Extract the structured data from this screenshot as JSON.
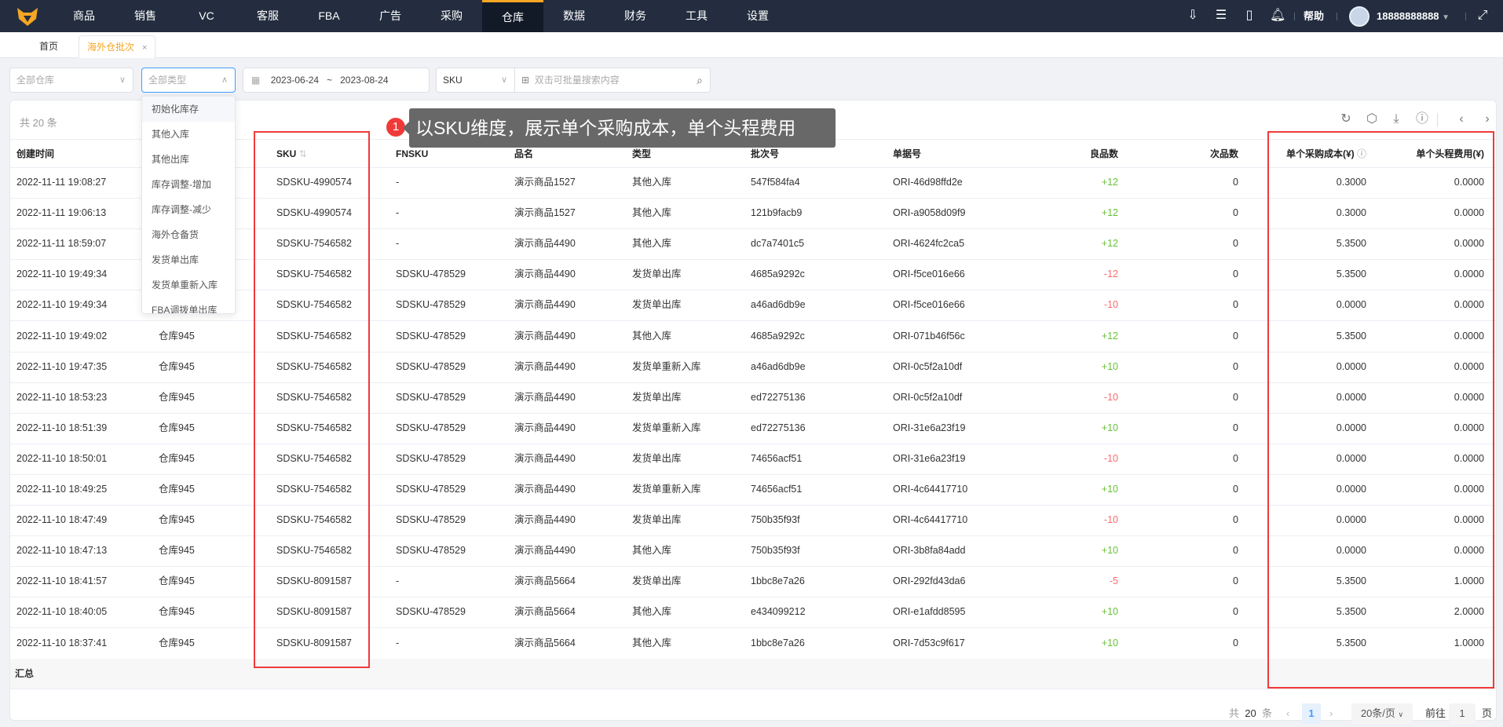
{
  "nav": {
    "items": [
      "商品",
      "销售",
      "VC",
      "客服",
      "FBA",
      "广告",
      "采购",
      "仓库",
      "数据",
      "财务",
      "工具",
      "设置"
    ],
    "active": 7,
    "help": "帮助",
    "user": "18888888888"
  },
  "tabs": {
    "home": "首页",
    "active": "海外仓批次",
    "close": "×"
  },
  "filters": {
    "warehouse": "全部仓库",
    "type": "全部类型",
    "date_start": "2023-06-24",
    "date_sep": "~",
    "date_end": "2023-08-24",
    "search_field": "SKU",
    "search_placeholder": "双击可批量搜索内容"
  },
  "dropdown": [
    "初始化库存",
    "其他入库",
    "其他出库",
    "库存调整-增加",
    "库存调整-减少",
    "海外仓备货",
    "发货单出库",
    "发货单重新入库",
    "FBA调拨单出库"
  ],
  "annotation": {
    "number": "1",
    "text": "以SKU维度，展示单个采购成本，单个头程费用"
  },
  "table": {
    "count": "共 20 条",
    "headers": {
      "time": "创建时间",
      "warehouse": "",
      "sku": "SKU",
      "fnsku": "FNSKU",
      "name": "品名",
      "type": "类型",
      "batch": "批次号",
      "doc": "单据号",
      "good": "良品数",
      "bad": "次品数",
      "cost": "单个采购成本(¥)",
      "freight": "单个头程费用(¥)"
    },
    "rows": [
      [
        "2022-11-11 19:08:27",
        "",
        "SDSKU-4990574",
        "-",
        "演示商品1527",
        "其他入库",
        "547f584fa4",
        "ORI-46d98ffd2e",
        "+12",
        "0",
        "0.3000",
        "0.0000"
      ],
      [
        "2022-11-11 19:06:13",
        "",
        "SDSKU-4990574",
        "-",
        "演示商品1527",
        "其他入库",
        "121b9facb9",
        "ORI-a9058d09f9",
        "+12",
        "0",
        "0.3000",
        "0.0000"
      ],
      [
        "2022-11-11 18:59:07",
        "",
        "SDSKU-7546582",
        "-",
        "演示商品4490",
        "其他入库",
        "dc7a7401c5",
        "ORI-4624fc2ca5",
        "+12",
        "0",
        "5.3500",
        "0.0000"
      ],
      [
        "2022-11-10 19:49:34",
        "",
        "SDSKU-7546582",
        "SDSKU-478529",
        "演示商品4490",
        "发货单出库",
        "4685a9292c",
        "ORI-f5ce016e66",
        "-12",
        "0",
        "5.3500",
        "0.0000"
      ],
      [
        "2022-11-10 19:49:34",
        "",
        "SDSKU-7546582",
        "SDSKU-478529",
        "演示商品4490",
        "发货单出库",
        "a46ad6db9e",
        "ORI-f5ce016e66",
        "-10",
        "0",
        "0.0000",
        "0.0000"
      ],
      [
        "2022-11-10 19:49:02",
        "仓库945",
        "SDSKU-7546582",
        "SDSKU-478529",
        "演示商品4490",
        "其他入库",
        "4685a9292c",
        "ORI-071b46f56c",
        "+12",
        "0",
        "5.3500",
        "0.0000"
      ],
      [
        "2022-11-10 19:47:35",
        "仓库945",
        "SDSKU-7546582",
        "SDSKU-478529",
        "演示商品4490",
        "发货单重新入库",
        "a46ad6db9e",
        "ORI-0c5f2a10df",
        "+10",
        "0",
        "0.0000",
        "0.0000"
      ],
      [
        "2022-11-10 18:53:23",
        "仓库945",
        "SDSKU-7546582",
        "SDSKU-478529",
        "演示商品4490",
        "发货单出库",
        "ed72275136",
        "ORI-0c5f2a10df",
        "-10",
        "0",
        "0.0000",
        "0.0000"
      ],
      [
        "2022-11-10 18:51:39",
        "仓库945",
        "SDSKU-7546582",
        "SDSKU-478529",
        "演示商品4490",
        "发货单重新入库",
        "ed72275136",
        "ORI-31e6a23f19",
        "+10",
        "0",
        "0.0000",
        "0.0000"
      ],
      [
        "2022-11-10 18:50:01",
        "仓库945",
        "SDSKU-7546582",
        "SDSKU-478529",
        "演示商品4490",
        "发货单出库",
        "74656acf51",
        "ORI-31e6a23f19",
        "-10",
        "0",
        "0.0000",
        "0.0000"
      ],
      [
        "2022-11-10 18:49:25",
        "仓库945",
        "SDSKU-7546582",
        "SDSKU-478529",
        "演示商品4490",
        "发货单重新入库",
        "74656acf51",
        "ORI-4c64417710",
        "+10",
        "0",
        "0.0000",
        "0.0000"
      ],
      [
        "2022-11-10 18:47:49",
        "仓库945",
        "SDSKU-7546582",
        "SDSKU-478529",
        "演示商品4490",
        "发货单出库",
        "750b35f93f",
        "ORI-4c64417710",
        "-10",
        "0",
        "0.0000",
        "0.0000"
      ],
      [
        "2022-11-10 18:47:13",
        "仓库945",
        "SDSKU-7546582",
        "SDSKU-478529",
        "演示商品4490",
        "其他入库",
        "750b35f93f",
        "ORI-3b8fa84add",
        "+10",
        "0",
        "0.0000",
        "0.0000"
      ],
      [
        "2022-11-10 18:41:57",
        "仓库945",
        "SDSKU-8091587",
        "-",
        "演示商品5664",
        "发货单出库",
        "1bbc8e7a26",
        "ORI-292fd43da6",
        "-5",
        "0",
        "5.3500",
        "1.0000"
      ],
      [
        "2022-11-10 18:40:05",
        "仓库945",
        "SDSKU-8091587",
        "SDSKU-478529",
        "演示商品5664",
        "其他入库",
        "e434099212",
        "ORI-e1afdd8595",
        "+10",
        "0",
        "5.3500",
        "2.0000"
      ],
      [
        "2022-11-10 18:37:41",
        "仓库945",
        "SDSKU-8091587",
        "-",
        "演示商品5664",
        "其他入库",
        "1bbc8e7a26",
        "ORI-7d53c9f617",
        "+10",
        "0",
        "5.3500",
        "1.0000"
      ]
    ],
    "summary": "汇总"
  },
  "pager": {
    "total_prefix": "共",
    "total": "20",
    "total_suffix": "条",
    "page": "1",
    "size": "20条/页",
    "goto": "前往",
    "goto_value": "1",
    "page_unit": "页"
  },
  "colors": {
    "accent": "#f5a623",
    "positive": "#67c23a",
    "negative": "#f56c6c",
    "highlight": "#f03a3a"
  }
}
